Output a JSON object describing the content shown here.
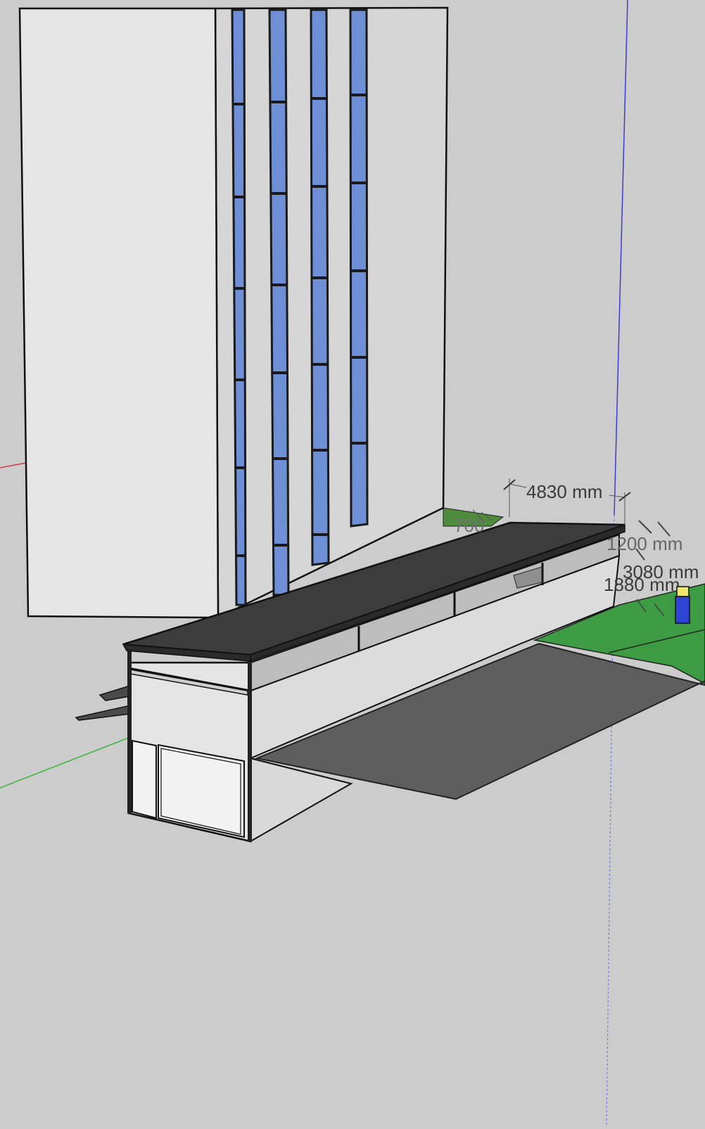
{
  "app": "SketchUp",
  "view": "3D model viewport",
  "colors": {
    "background": "#cccccc",
    "wall_light": "#e6e6e6",
    "wall_side": "#d6d6d6",
    "glass": "#6e8fd6",
    "roof": "#3c3c3c",
    "pavement": "#5e5e5e",
    "grass": "#3d9c43",
    "axis_red": "#d23c3c",
    "axis_green": "#3bb43b",
    "axis_blue": "#3c3cd2"
  },
  "dimensions": {
    "d1": "4830 mm",
    "d2": "700",
    "d3": "1200 mm",
    "d4": "3080 mm",
    "d5": "1880 mm"
  }
}
